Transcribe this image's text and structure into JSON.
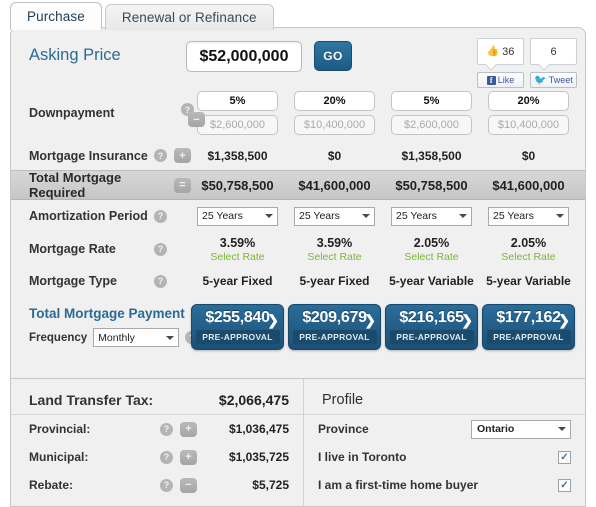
{
  "tabs": [
    {
      "label": "Purchase",
      "active": true
    },
    {
      "label": "Renewal or Refinance",
      "active": false
    }
  ],
  "header": {
    "asking_price_label": "Asking Price",
    "asking_price_value": "$52,000,000",
    "go_label": "GO"
  },
  "social": {
    "facebook_count": "36",
    "twitter_count": "6",
    "like_label": "Like",
    "tweet_label": "Tweet"
  },
  "rows": {
    "downpayment_label": "Downpayment",
    "mortgage_insurance_label": "Mortgage Insurance",
    "total_mortgage_label": "Total Mortgage Required",
    "amortization_label": "Amortization Period",
    "mortgage_rate_label": "Mortgage Rate",
    "mortgage_type_label": "Mortgage Type",
    "total_payment_label": "Total Mortgage Payment",
    "frequency_label": "Frequency",
    "frequency_value": "Monthly",
    "select_rate_label": "Select Rate",
    "pre_approval_label": "PRE-APPROVAL",
    "op_minus": "−",
    "op_plus": "+",
    "op_equals": "=",
    "help_glyph": "?"
  },
  "columns": [
    {
      "downpayment_pct": "5%",
      "downpayment_amount": "$2,600,000",
      "mortgage_insurance": "$1,358,500",
      "total_mortgage": "$50,758,500",
      "amortization": "25 Years",
      "rate": "3.59%",
      "type": "5-year Fixed",
      "payment": "$255,840"
    },
    {
      "downpayment_pct": "20%",
      "downpayment_amount": "$10,400,000",
      "mortgage_insurance": "$0",
      "total_mortgage": "$41,600,000",
      "amortization": "25 Years",
      "rate": "3.59%",
      "type": "5-year Fixed",
      "payment": "$209,679"
    },
    {
      "downpayment_pct": "5%",
      "downpayment_amount": "$2,600,000",
      "mortgage_insurance": "$1,358,500",
      "total_mortgage": "$50,758,500",
      "amortization": "25 Years",
      "rate": "2.05%",
      "type": "5-year Variable",
      "payment": "$216,165"
    },
    {
      "downpayment_pct": "20%",
      "downpayment_amount": "$10,400,000",
      "mortgage_insurance": "$0",
      "total_mortgage": "$41,600,000",
      "amortization": "25 Years",
      "rate": "2.05%",
      "type": "5-year Variable",
      "payment": "$177,162"
    }
  ],
  "land_transfer_tax": {
    "title": "Land Transfer Tax:",
    "total": "$2,066,475",
    "items": [
      {
        "label": "Provincial:",
        "op": "+",
        "value": "$1,036,475"
      },
      {
        "label": "Municipal:",
        "op": "+",
        "value": "$1,035,725"
      },
      {
        "label": "Rebate:",
        "op": "−",
        "value": "$5,725"
      }
    ]
  },
  "profile": {
    "title": "Profile",
    "province_label": "Province",
    "province_value": "Ontario",
    "toronto_label": "I live in Toronto",
    "toronto_checked": true,
    "firsttime_label": "I am a first-time home buyer",
    "firsttime_checked": true,
    "check_glyph": "✓"
  }
}
